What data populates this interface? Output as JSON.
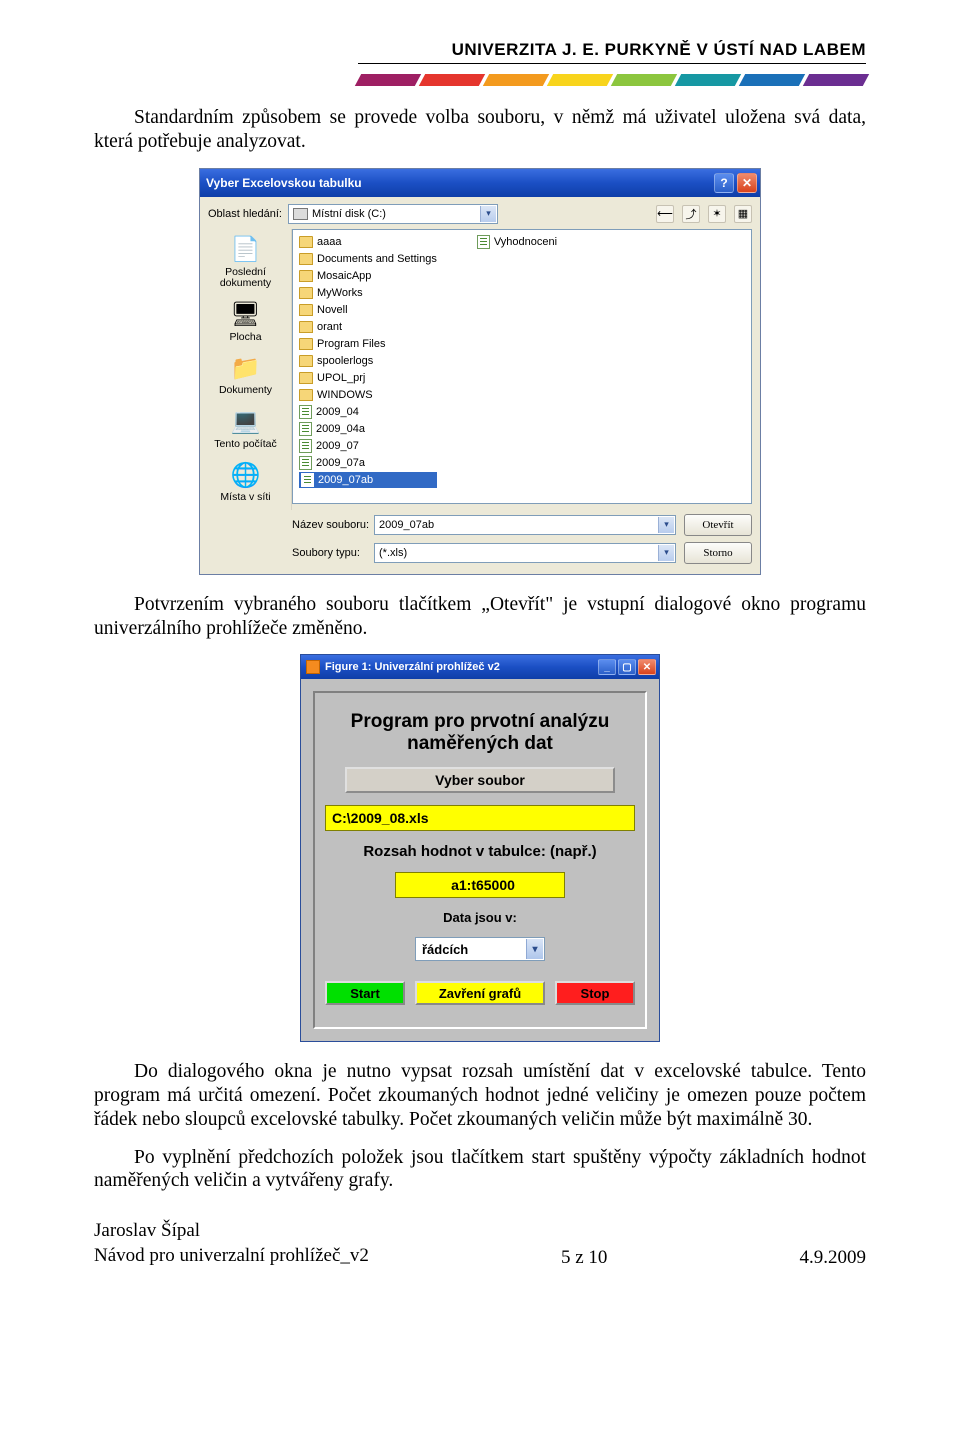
{
  "header": {
    "university": "UNIVERZITA J. E. PURKYNĚ V ÚSTÍ NAD LABEM",
    "stripe_colors": [
      "#9e1f63",
      "#e5352d",
      "#f39a1e",
      "#f8d41c",
      "#8cc63e",
      "#1698a3",
      "#1a70b8",
      "#6b2e91"
    ]
  },
  "para1": "Standardním způsobem se provede volba souboru, v němž má uživatel uložena svá data, která potřebuje analyzovat.",
  "para2": "Potvrzením vybraného souboru tlačítkem „Otevřít\" je vstupní dialogové okno programu univerzálního prohlížeče změněno.",
  "para3": "Do dialogového okna je nutno vypsat rozsah umístění dat v excelovské tabulce. Tento program má určitá omezení. Počet zkoumaných hodnot jedné veličiny je omezen pouze počtem řádek nebo sloupců excelovské tabulky. Počet zkoumaných veličin může být maximálně 30.",
  "para4": "Po vyplnění předchozích položek jsou tlačítkem start spuštěny výpočty základních hodnot naměřených veličin a vytvářeny grafy.",
  "dialog": {
    "title": "Vyber Excelovskou tabulku",
    "lookin_label": "Oblast hledání:",
    "lookin_value": "Místní disk (C:)",
    "places": [
      "Poslední dokumenty",
      "Plocha",
      "Dokumenty",
      "Tento počítač",
      "Místa v síti"
    ],
    "folders": [
      "aaaa",
      "Documents and Settings",
      "MosaicApp",
      "MyWorks",
      "Novell",
      "orant",
      "Program Files",
      "spoolerlogs",
      "UPOL_prj",
      "WINDOWS"
    ],
    "xls_files": [
      "2009_04",
      "2009_04a",
      "2009_07",
      "2009_07a",
      "2009_07ab"
    ],
    "col2_file": "Vyhodnoceni",
    "filename_label": "Název souboru:",
    "filename_value": "2009_07ab",
    "filetype_label": "Soubory typu:",
    "filetype_value": "(*.xls)",
    "open_btn": "Otevřít",
    "cancel_btn": "Storno"
  },
  "matlab": {
    "title": "Figure 1: Univerzální prohlížeč v2",
    "heading": "Program pro prvotní analýzu naměřených dat",
    "select_btn": "Vyber soubor",
    "filepath": "C:\\2009_08.xls",
    "range_label": "Rozsah hodnot v tabulce: (např.)",
    "range_value": "a1:t65000",
    "data_label": "Data jsou v:",
    "data_value": "řádcích",
    "start": "Start",
    "close": "Zavření grafů",
    "stop": "Stop"
  },
  "footer": {
    "author": "Jaroslav Šípal",
    "doc": "Návod pro univerzalní prohlížeč_v2",
    "page": "5 z 10",
    "date": "4.9.2009"
  }
}
